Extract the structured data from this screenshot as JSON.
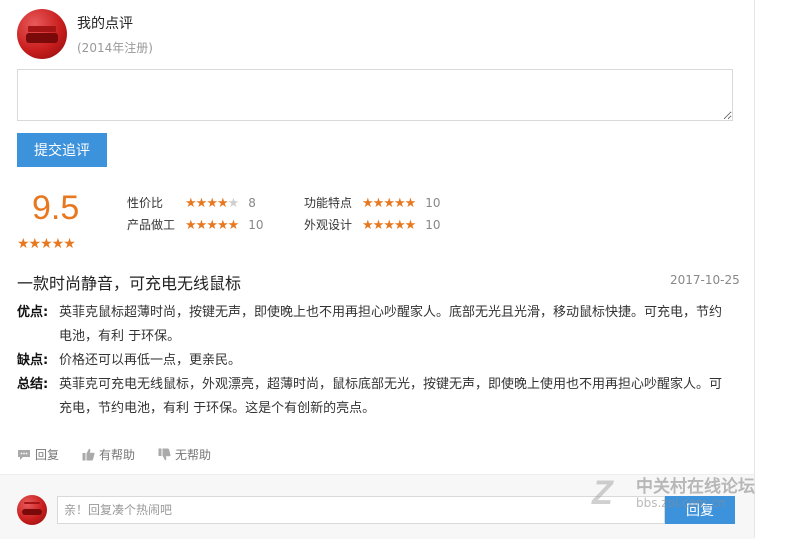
{
  "user": {
    "name": "我的点评",
    "registered": "(2014年注册)"
  },
  "followup": {
    "submit_label": "提交追评"
  },
  "score": {
    "overall": "9.5",
    "stars": "★★★★★"
  },
  "ratings": [
    {
      "label": "性价比",
      "stars": 4,
      "max": 5,
      "value": "8"
    },
    {
      "label": "功能特点",
      "stars": 5,
      "max": 5,
      "value": "10"
    },
    {
      "label": "产品做工",
      "stars": 5,
      "max": 5,
      "value": "10"
    },
    {
      "label": "外观设计",
      "stars": 5,
      "max": 5,
      "value": "10"
    }
  ],
  "review": {
    "title": "一款时尚静音，可充电无线鼠标",
    "date": "2017-10-25",
    "pros_label": "优点:",
    "pros": "英菲克鼠标超薄时尚，按键无声，即使晚上也不用再担心吵醒家人。底部无光且光滑，移动鼠标快捷。可充电，节约电池，有利 于环保。",
    "cons_label": "缺点:",
    "cons": "价格还可以再低一点，更亲民。",
    "summary_label": "总结:",
    "summary": "英菲克可充电无线鼠标，外观漂亮，超薄时尚，鼠标底部无光，按键无声，即使晚上使用也不用再担心吵醒家人。可充电，节约电池，有利 于环保。这是个有创新的亮点。"
  },
  "actions": {
    "reply": "回复",
    "helpful": "有帮助",
    "unhelpful": "无帮助"
  },
  "reply_box": {
    "placeholder": "亲！回复凑个热闹吧",
    "button": "回复"
  },
  "watermark": {
    "name": "中关村在线论坛",
    "url": "bbs.zol.com.cn"
  },
  "colors": {
    "accent": "#3d92dc",
    "star": "#e8781f"
  }
}
